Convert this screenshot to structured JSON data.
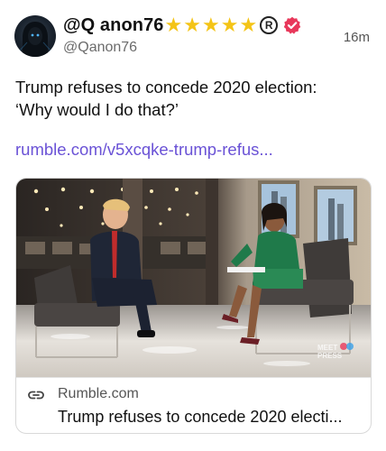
{
  "author": {
    "display_name": "@Q anon76",
    "stars": [
      "★",
      "★",
      "★",
      "★",
      "★"
    ],
    "reg_mark": "R",
    "handle": "@Qanon76",
    "avatar_icon": "hooded-figure-avatar",
    "verified_color": "#e8385b"
  },
  "timestamp": "16m",
  "post": {
    "text_lines": [
      "Trump refuses to concede 2020 election:",
      "‘Why would I do that?’"
    ],
    "link": "rumble.com/v5xcqke-trump-refus..."
  },
  "link_card": {
    "domain": "Rumble.com",
    "title": "Trump refuses to concede 2020 electi...",
    "watermark": "MEET THE PRESS",
    "icon": "link-icon"
  },
  "colors": {
    "star": "#f4c417",
    "link": "#6a52d6",
    "handle": "#6b6b6b"
  }
}
